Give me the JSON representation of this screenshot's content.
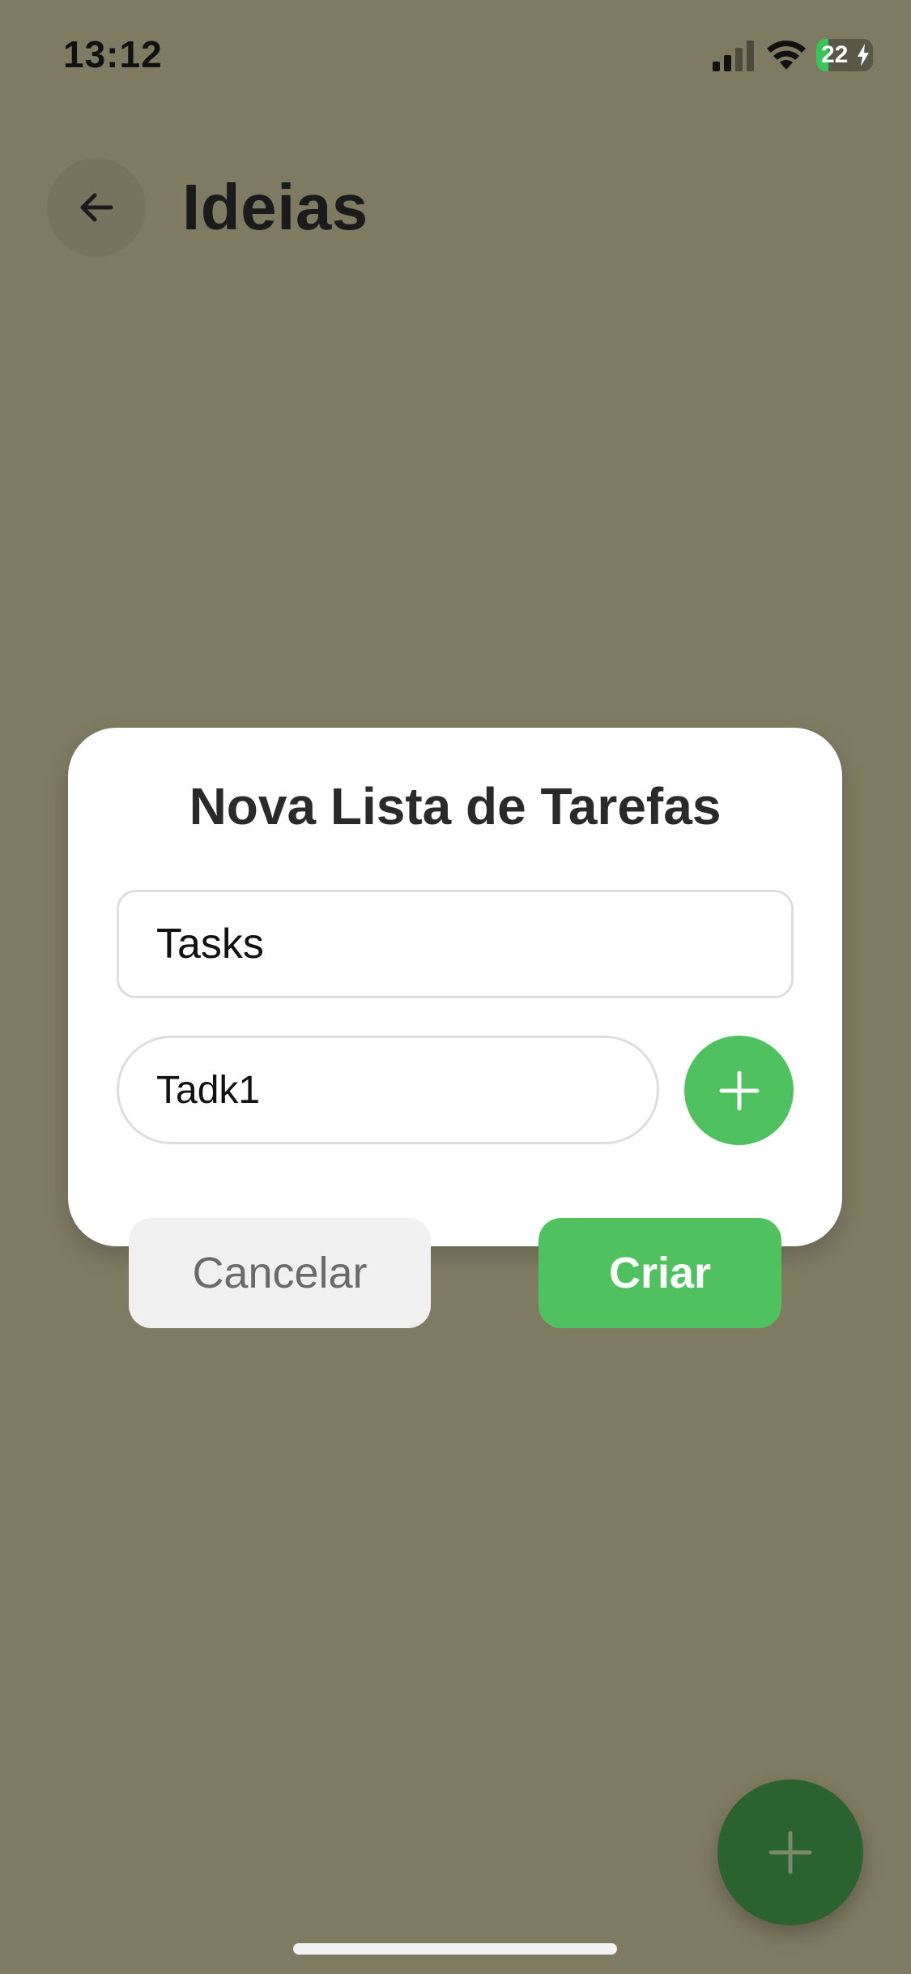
{
  "status_bar": {
    "time": "13:12",
    "battery_level": "22",
    "battery_charging": true,
    "icons": [
      "signal-icon",
      "wifi-icon",
      "battery-icon",
      "charging-bolt-icon"
    ]
  },
  "header": {
    "title": "Ideias",
    "back_icon": "arrow-left-icon"
  },
  "modal": {
    "title": "Nova Lista de Tarefas",
    "list_name_value": "Tasks",
    "task_input_value": "Tadk1",
    "add_task_icon": "plus-icon",
    "cancel_label": "Cancelar",
    "create_label": "Criar"
  },
  "fab": {
    "icon": "plus-icon"
  },
  "colors": {
    "background_dim": "#7f7b63",
    "accent_green": "#4fc15e",
    "fab_green": "#2b6330",
    "card": "#ffffff",
    "cancel_bg": "#f0f0f0"
  }
}
